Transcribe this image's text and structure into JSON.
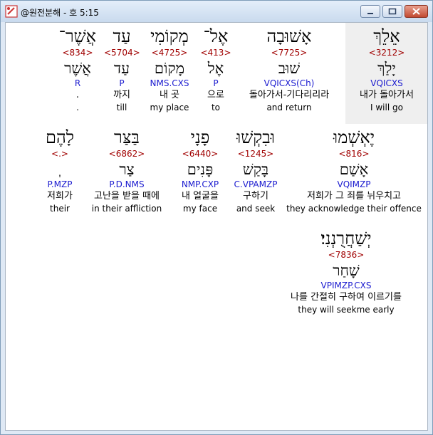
{
  "window": {
    "title": "@원전분해 - 호 5:15"
  },
  "words": [
    {
      "hebrew": "אֵלֵךְ",
      "strong": "<3212>",
      "lemma": "יָלַךְ",
      "morph": "VQICXS",
      "korean": "내가 돌아가서",
      "english": "I will go"
    },
    {
      "hebrew": "אָשׁוּבָה",
      "strong": "<7725>",
      "lemma": "שׁוּב",
      "morph": "VQICXS(Ch)",
      "korean": "돌아가서-기다리리라",
      "english": "and return"
    },
    {
      "hebrew": "אֶל־",
      "strong": "<413>",
      "lemma": "אֶל",
      "morph": "P",
      "korean": "으로",
      "english": "to"
    },
    {
      "hebrew": "מְקוֹמִי",
      "strong": "<4725>",
      "lemma": "מָקוֹם",
      "morph": "NMS.CXS",
      "korean": "내 곳",
      "english": "my place"
    },
    {
      "hebrew": "עַד",
      "strong": "<5704>",
      "lemma": "עַד",
      "morph": "P",
      "korean": "까지",
      "english": "till"
    },
    {
      "hebrew": "אֲשֶׁר־",
      "strong": "<834>",
      "lemma": "אֲשֶׁר",
      "morph": "R",
      "korean": ".",
      "english": "."
    },
    {
      "hebrew": "יֶאְשְׁמוּ",
      "strong": "<816>",
      "lemma": "אָשַׁם",
      "morph": "VQIMZP",
      "korean": "저희가 그 죄를 뉘우치고",
      "english": "they acknowledge their offence"
    },
    {
      "hebrew": "וּבִקְשׁוּ",
      "strong": "<1245>",
      "lemma": "בָּקַשׁ",
      "morph": "C.VPAMZP",
      "korean": "구하기",
      "english": "and seek"
    },
    {
      "hebrew": "פָנָי",
      "strong": "<6440>",
      "lemma": "פָּנִים",
      "morph": "NMP.CXP",
      "korean": "내 얼굴을",
      "english": "my face"
    },
    {
      "hebrew": "בַּצַּר",
      "strong": "<6862>",
      "lemma": "צַר",
      "morph": "P.D.NMS",
      "korean": "고난을 받을 때에",
      "english": "in their affliction"
    },
    {
      "hebrew": "לָהֶם",
      "strong": "<.>",
      "lemma": "ְ",
      "morph": "P.MZP",
      "korean": "저희가",
      "english": "their"
    },
    {
      "hebrew": "יְשַׁחֲרֻנְנִי׃",
      "strong": "<7836>",
      "lemma": "שָׁחַר",
      "morph": "VPIMZP.CXS",
      "korean": "나를 간절히 구하여 이르기를",
      "english": "they will seekme early"
    }
  ]
}
